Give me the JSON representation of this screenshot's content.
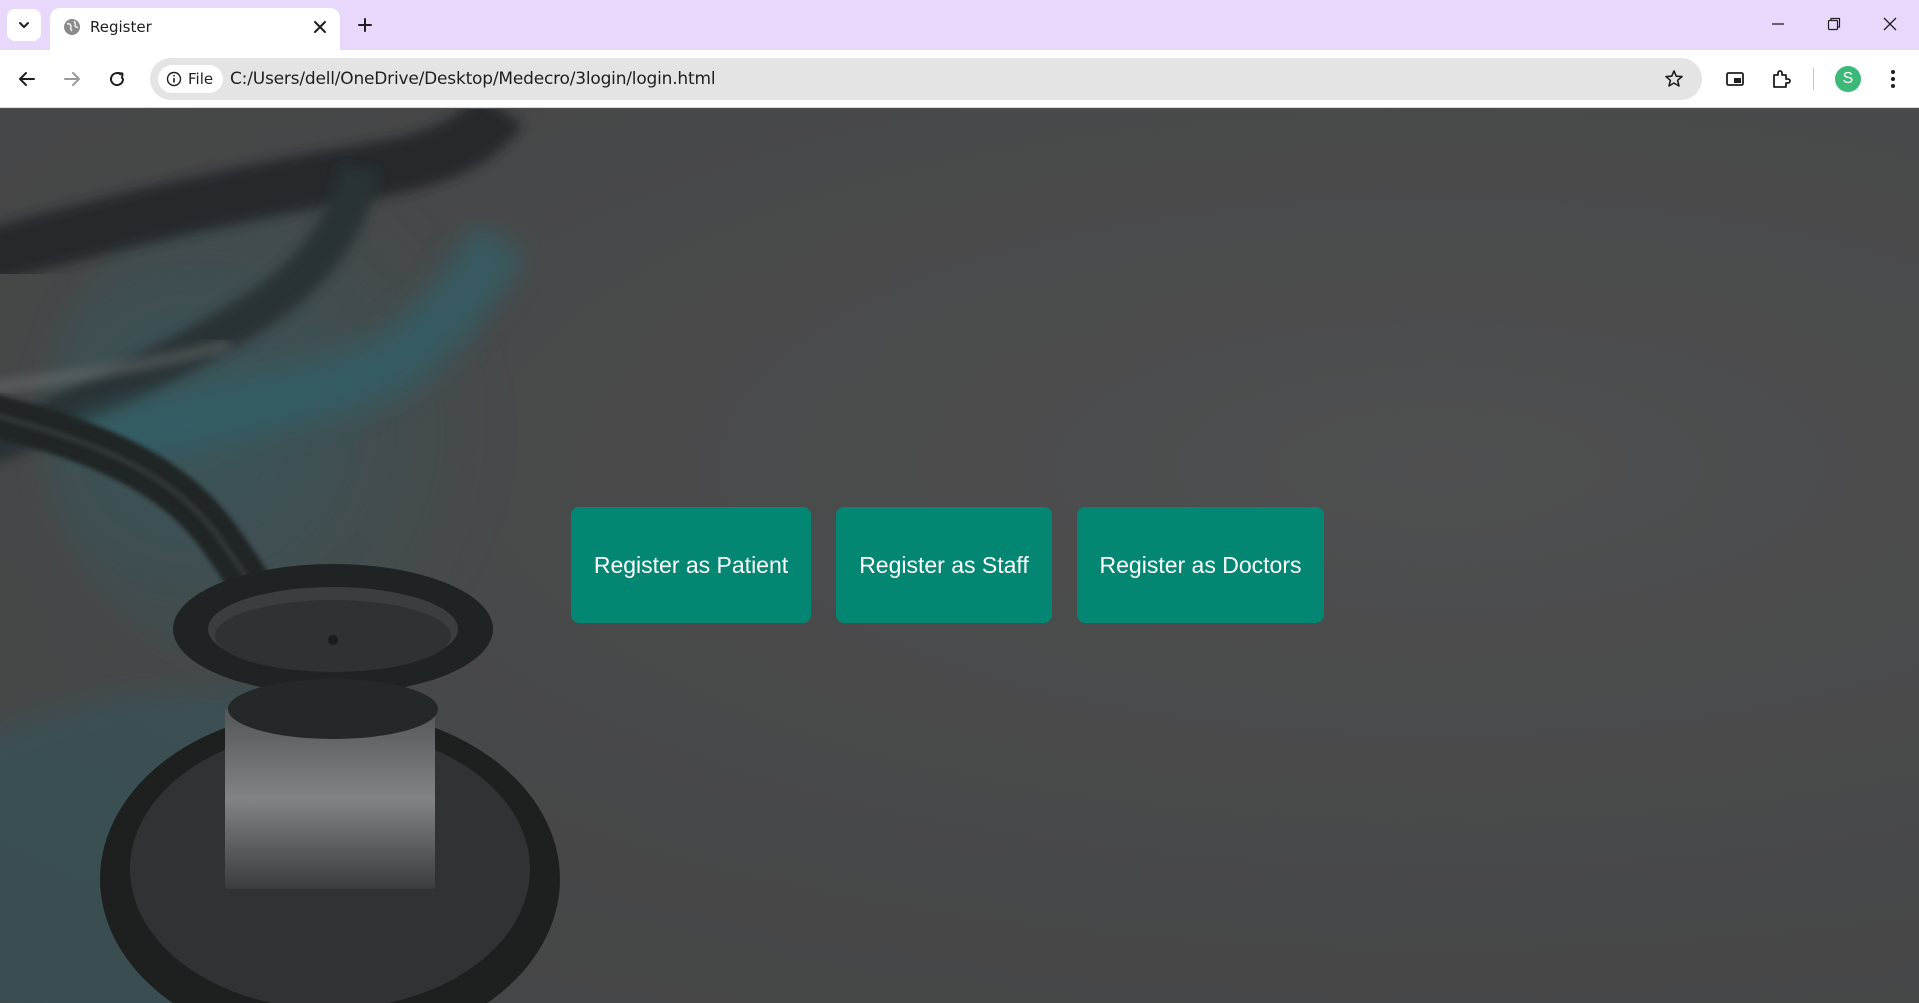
{
  "browser": {
    "tab_title": "Register",
    "site_chip_label": "File",
    "url": "C:/Users/dell/OneDrive/Desktop/Medecro/3login/login.html",
    "profile_initial": "S"
  },
  "page": {
    "buttons": [
      {
        "label": "Register as Patient"
      },
      {
        "label": "Register as Staff"
      },
      {
        "label": "Register as Doctors"
      }
    ]
  },
  "colors": {
    "tabbar": "#e8d8fb",
    "button": "#038772",
    "avatar": "#3cb878"
  },
  "icons": [
    "tab-search-icon",
    "globe-icon",
    "close-icon",
    "plus-icon",
    "minimize-icon",
    "restore-icon",
    "window-close-icon",
    "back-arrow-icon",
    "forward-arrow-icon",
    "reload-icon",
    "info-icon",
    "star-icon",
    "picture-in-picture-icon",
    "extensions-icon",
    "more-vert-icon"
  ]
}
